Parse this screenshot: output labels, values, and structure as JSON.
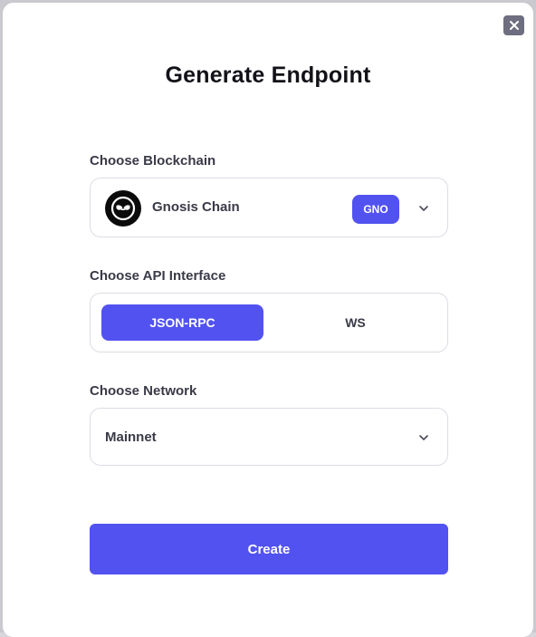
{
  "modal": {
    "title": "Generate Endpoint",
    "close_icon": "close-icon"
  },
  "blockchain": {
    "label": "Choose Blockchain",
    "selected_name": "Gnosis Chain",
    "ticker": "GNO",
    "logo_icon": "gnosis-logo-icon"
  },
  "api_interface": {
    "label": "Choose API Interface",
    "options": [
      "JSON-RPC",
      "WS"
    ],
    "selected": "JSON-RPC"
  },
  "network": {
    "label": "Choose Network",
    "selected": "Mainnet"
  },
  "actions": {
    "create_label": "Create"
  },
  "colors": {
    "accent": "#5252f0",
    "close_button_bg": "#6e6e80",
    "text_primary": "#121218",
    "text_secondary": "#3a3a48",
    "border": "#dcdce4"
  }
}
